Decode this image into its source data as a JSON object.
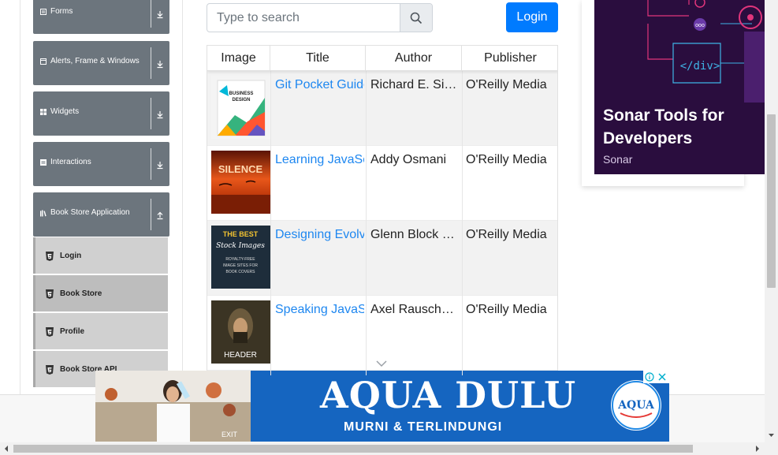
{
  "sidebar": {
    "groups": [
      {
        "label": "Forms",
        "icon": "form-icon",
        "arrow": "down"
      },
      {
        "label": "Alerts, Frame & Windows",
        "icon": "window-icon",
        "arrow": "down"
      },
      {
        "label": "Widgets",
        "icon": "widgets-icon",
        "arrow": "down"
      },
      {
        "label": "Interactions",
        "icon": "interactions-icon",
        "arrow": "down"
      },
      {
        "label": "Book Store Application",
        "icon": "book-icon",
        "arrow": "up"
      }
    ],
    "items": [
      {
        "label": "Login",
        "active": false
      },
      {
        "label": "Book Store",
        "active": true
      },
      {
        "label": "Profile",
        "active": false
      },
      {
        "label": "Book Store API",
        "active": false
      }
    ]
  },
  "search": {
    "placeholder": "Type to search"
  },
  "login_label": "Login",
  "table": {
    "headers": [
      "Image",
      "Title",
      "Author",
      "Publisher"
    ],
    "rows": [
      {
        "title": "Git Pocket Guide",
        "author": "Richard E. Silverman",
        "publisher": "O'Reilly Media"
      },
      {
        "title": "Learning JavaScript Design Patterns",
        "author": "Addy Osmani",
        "publisher": "O'Reilly Media"
      },
      {
        "title": "Designing Evolvable Web APIs with ASP.NET",
        "author": "Glenn Block et al.",
        "publisher": "O'Reilly Media"
      },
      {
        "title": "Speaking JavaScript",
        "author": "Axel Rauschmayer",
        "publisher": "O'Reilly Media"
      }
    ],
    "covers": [
      {
        "line1": "BUSINESS",
        "line2": "DESIGN"
      },
      {
        "line1": "SILENCE"
      },
      {
        "line1": "THE BEST",
        "line2": "Stock Images",
        "line3": "ROYALTY-FREE",
        "line4": "IMAGE SITES FOR",
        "line5": "BOOK COVERS"
      },
      {
        "line1": "HEADER"
      }
    ]
  },
  "right_ad": {
    "title": "Sonar Tools for Developers",
    "sponsor": "Sonar",
    "code_label": "</div>"
  },
  "bottom_ad": {
    "brand": "AQUA DULU",
    "tagline": "MURNI & TERLINDUNGI",
    "logo_text": "AQUA",
    "photo_text": "EXIT"
  },
  "colors": {
    "accent": "#007bff",
    "sidebar_group": "#6c757d",
    "link": "#1e87f0",
    "ad_purple": "#2a0d3e",
    "ad_blue": "#1565c0"
  }
}
